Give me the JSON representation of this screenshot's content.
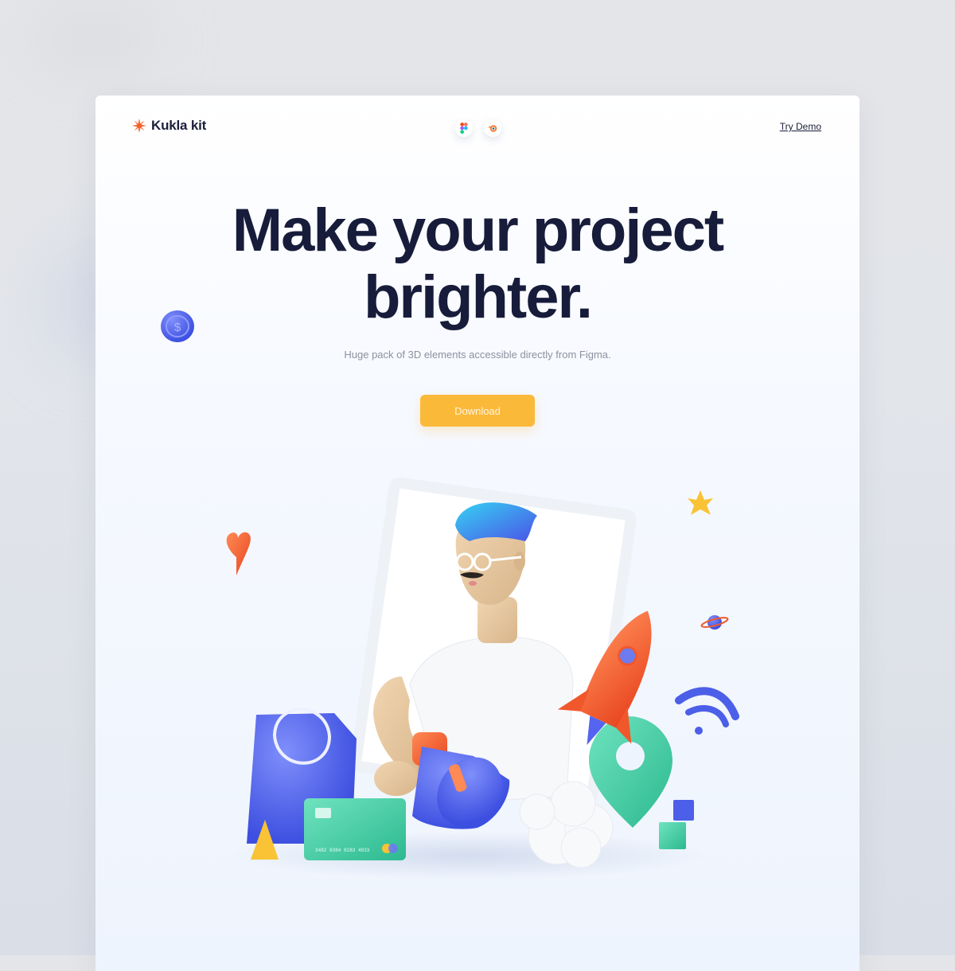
{
  "brand": {
    "name": "Kukla kit",
    "icon": "sun-burst-icon",
    "accent": "#f2622b"
  },
  "nav": {
    "tools": [
      {
        "name": "figma-icon"
      },
      {
        "name": "blender-icon"
      }
    ],
    "try_demo_label": "Try Demo"
  },
  "hero": {
    "title_line1": "Make your project",
    "title_line2": "brighter.",
    "subtitle": "Huge pack of 3D elements accessible directly from Figma.",
    "download_label": "Download",
    "download_color": "#fbb93a"
  },
  "illustration": {
    "card_number": "3482 8384 8283 4833",
    "colors": {
      "blue": "#4c5fe8",
      "orange": "#f0582c",
      "mint": "#3fcfa6",
      "yellow": "#f9c335",
      "hair": "#3bb8f0"
    }
  }
}
